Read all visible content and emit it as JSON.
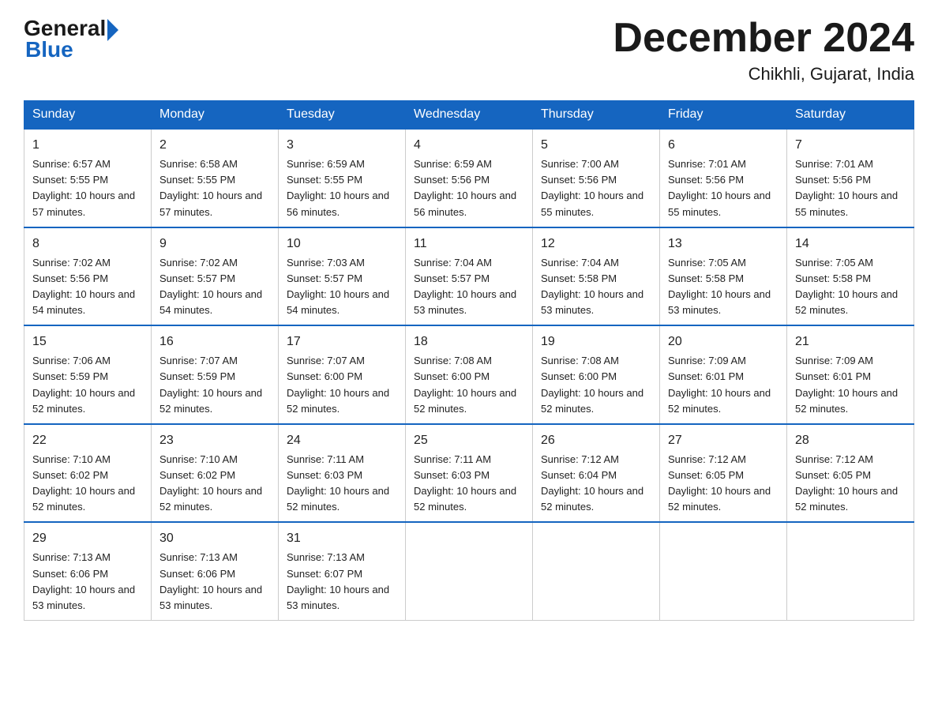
{
  "header": {
    "logo_general": "General",
    "logo_blue": "Blue",
    "month_title": "December 2024",
    "location": "Chikhli, Gujarat, India"
  },
  "days_of_week": [
    "Sunday",
    "Monday",
    "Tuesday",
    "Wednesday",
    "Thursday",
    "Friday",
    "Saturday"
  ],
  "weeks": [
    [
      {
        "day": "1",
        "sunrise": "6:57 AM",
        "sunset": "5:55 PM",
        "daylight": "10 hours and 57 minutes."
      },
      {
        "day": "2",
        "sunrise": "6:58 AM",
        "sunset": "5:55 PM",
        "daylight": "10 hours and 57 minutes."
      },
      {
        "day": "3",
        "sunrise": "6:59 AM",
        "sunset": "5:55 PM",
        "daylight": "10 hours and 56 minutes."
      },
      {
        "day": "4",
        "sunrise": "6:59 AM",
        "sunset": "5:56 PM",
        "daylight": "10 hours and 56 minutes."
      },
      {
        "day": "5",
        "sunrise": "7:00 AM",
        "sunset": "5:56 PM",
        "daylight": "10 hours and 55 minutes."
      },
      {
        "day": "6",
        "sunrise": "7:01 AM",
        "sunset": "5:56 PM",
        "daylight": "10 hours and 55 minutes."
      },
      {
        "day": "7",
        "sunrise": "7:01 AM",
        "sunset": "5:56 PM",
        "daylight": "10 hours and 55 minutes."
      }
    ],
    [
      {
        "day": "8",
        "sunrise": "7:02 AM",
        "sunset": "5:56 PM",
        "daylight": "10 hours and 54 minutes."
      },
      {
        "day": "9",
        "sunrise": "7:02 AM",
        "sunset": "5:57 PM",
        "daylight": "10 hours and 54 minutes."
      },
      {
        "day": "10",
        "sunrise": "7:03 AM",
        "sunset": "5:57 PM",
        "daylight": "10 hours and 54 minutes."
      },
      {
        "day": "11",
        "sunrise": "7:04 AM",
        "sunset": "5:57 PM",
        "daylight": "10 hours and 53 minutes."
      },
      {
        "day": "12",
        "sunrise": "7:04 AM",
        "sunset": "5:58 PM",
        "daylight": "10 hours and 53 minutes."
      },
      {
        "day": "13",
        "sunrise": "7:05 AM",
        "sunset": "5:58 PM",
        "daylight": "10 hours and 53 minutes."
      },
      {
        "day": "14",
        "sunrise": "7:05 AM",
        "sunset": "5:58 PM",
        "daylight": "10 hours and 52 minutes."
      }
    ],
    [
      {
        "day": "15",
        "sunrise": "7:06 AM",
        "sunset": "5:59 PM",
        "daylight": "10 hours and 52 minutes."
      },
      {
        "day": "16",
        "sunrise": "7:07 AM",
        "sunset": "5:59 PM",
        "daylight": "10 hours and 52 minutes."
      },
      {
        "day": "17",
        "sunrise": "7:07 AM",
        "sunset": "6:00 PM",
        "daylight": "10 hours and 52 minutes."
      },
      {
        "day": "18",
        "sunrise": "7:08 AM",
        "sunset": "6:00 PM",
        "daylight": "10 hours and 52 minutes."
      },
      {
        "day": "19",
        "sunrise": "7:08 AM",
        "sunset": "6:00 PM",
        "daylight": "10 hours and 52 minutes."
      },
      {
        "day": "20",
        "sunrise": "7:09 AM",
        "sunset": "6:01 PM",
        "daylight": "10 hours and 52 minutes."
      },
      {
        "day": "21",
        "sunrise": "7:09 AM",
        "sunset": "6:01 PM",
        "daylight": "10 hours and 52 minutes."
      }
    ],
    [
      {
        "day": "22",
        "sunrise": "7:10 AM",
        "sunset": "6:02 PM",
        "daylight": "10 hours and 52 minutes."
      },
      {
        "day": "23",
        "sunrise": "7:10 AM",
        "sunset": "6:02 PM",
        "daylight": "10 hours and 52 minutes."
      },
      {
        "day": "24",
        "sunrise": "7:11 AM",
        "sunset": "6:03 PM",
        "daylight": "10 hours and 52 minutes."
      },
      {
        "day": "25",
        "sunrise": "7:11 AM",
        "sunset": "6:03 PM",
        "daylight": "10 hours and 52 minutes."
      },
      {
        "day": "26",
        "sunrise": "7:12 AM",
        "sunset": "6:04 PM",
        "daylight": "10 hours and 52 minutes."
      },
      {
        "day": "27",
        "sunrise": "7:12 AM",
        "sunset": "6:05 PM",
        "daylight": "10 hours and 52 minutes."
      },
      {
        "day": "28",
        "sunrise": "7:12 AM",
        "sunset": "6:05 PM",
        "daylight": "10 hours and 52 minutes."
      }
    ],
    [
      {
        "day": "29",
        "sunrise": "7:13 AM",
        "sunset": "6:06 PM",
        "daylight": "10 hours and 53 minutes."
      },
      {
        "day": "30",
        "sunrise": "7:13 AM",
        "sunset": "6:06 PM",
        "daylight": "10 hours and 53 minutes."
      },
      {
        "day": "31",
        "sunrise": "7:13 AM",
        "sunset": "6:07 PM",
        "daylight": "10 hours and 53 minutes."
      },
      null,
      null,
      null,
      null
    ]
  ]
}
